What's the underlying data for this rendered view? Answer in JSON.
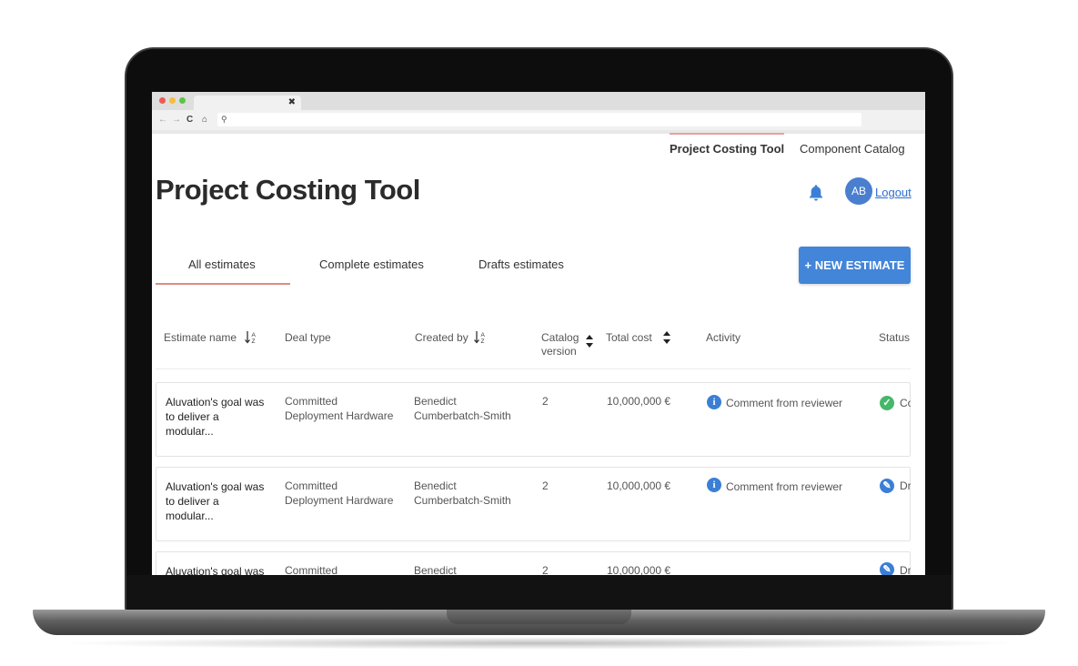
{
  "nav": {
    "active_item": "Project Costing Tool",
    "catalog_item": "Component Catalog"
  },
  "page": {
    "title": "Project Costing Tool"
  },
  "user": {
    "initials": "AB",
    "logout_label": "Logout"
  },
  "tabs": [
    {
      "label": "All estimates",
      "active": true
    },
    {
      "label": "Complete estimates",
      "active": false
    },
    {
      "label": "Drafts estimates",
      "active": false
    }
  ],
  "new_estimate_label": "+ NEW ESTIMATE",
  "table": {
    "headers": {
      "name": "Estimate name",
      "deal_type": "Deal type",
      "created_by": "Created by",
      "catalog_line1": "Catalog",
      "catalog_line2": "version",
      "total_cost": "Total cost",
      "activity": "Activity",
      "status": "Status"
    },
    "rows": [
      {
        "name_l1": "Aluvation's goal was",
        "name_l2": "to deliver a",
        "name_l3": "modular...",
        "deal_l1": "Committed",
        "deal_l2": "Deployment Hardware",
        "created_l1": "Benedict",
        "created_l2": "Cumberbatch-Smith",
        "catalog": "2",
        "cost": "10,000,000 €",
        "activity": "Comment from reviewer",
        "status": "Co"
      },
      {
        "name_l1": "Aluvation's goal was",
        "name_l2": "to deliver a",
        "name_l3": "modular...",
        "deal_l1": "Committed",
        "deal_l2": "Deployment Hardware",
        "created_l1": "Benedict",
        "created_l2": "Cumberbatch-Smith",
        "catalog": "2",
        "cost": "10,000,000 €",
        "activity": "Comment from reviewer",
        "status": "Dr"
      },
      {
        "name_l1": "Aluvation's goal was",
        "deal_l1": "Committed",
        "created_l1": "Benedict",
        "catalog": "2",
        "cost": "10,000,000 €",
        "status": "Dr"
      }
    ]
  },
  "colors": {
    "accent": "#4285d9",
    "tab_underline": "#e08a84",
    "status_complete": "#46b86a"
  }
}
